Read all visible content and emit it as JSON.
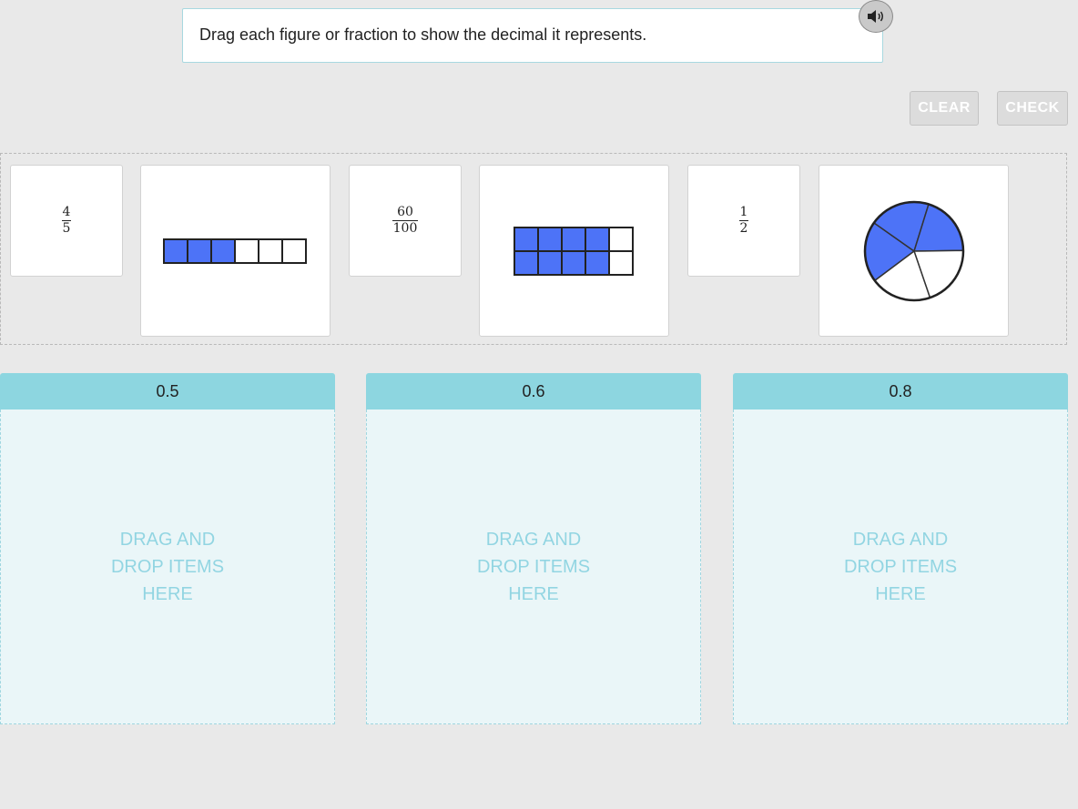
{
  "instruction": "Drag each figure or fraction to show the decimal it represents.",
  "audio": {
    "icon": "speaker-icon"
  },
  "buttons": {
    "clear": "CLEAR",
    "check": "CHECK"
  },
  "colors": {
    "fill": "#4d73f7",
    "zone_header": "#8dd6e0",
    "zone_body": "#eaf6f8",
    "hint": "#92d5e2"
  },
  "bank": {
    "fraction_4_5": {
      "numerator": "4",
      "denominator": "5"
    },
    "strip_model": {
      "filled": 3,
      "total": 6
    },
    "fraction_60_100": {
      "numerator": "60",
      "denominator": "100"
    },
    "grid_model": {
      "rows": 2,
      "cols": 5,
      "filled": 8
    },
    "fraction_1_2": {
      "numerator": "1",
      "denominator": "2"
    },
    "pie_model": {
      "filled": 3,
      "total": 5
    }
  },
  "zones": [
    {
      "label": "0.5",
      "hint": "DRAG AND\nDROP ITEMS\nHERE"
    },
    {
      "label": "0.6",
      "hint": "DRAG AND\nDROP ITEMS\nHERE"
    },
    {
      "label": "0.8",
      "hint": "DRAG AND\nDROP ITEMS\nHERE"
    }
  ]
}
